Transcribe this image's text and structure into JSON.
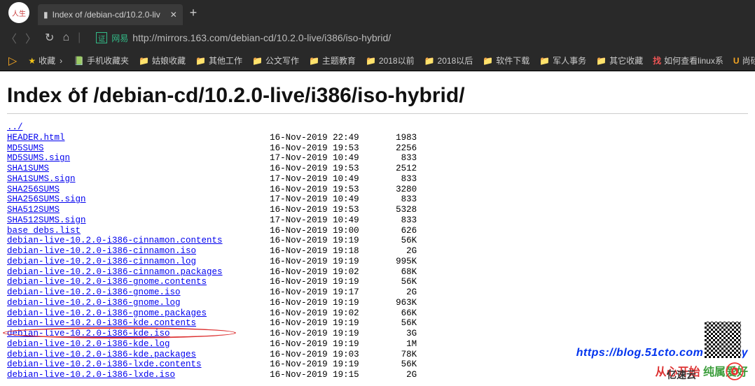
{
  "tab": {
    "title": "Index of /debian-cd/10.2.0-liv"
  },
  "url": "http://mirrors.163.com/debian-cd/10.2.0-live/i386/iso-hybrid/",
  "security_label": "网易",
  "bookmarks": {
    "fav": "收藏",
    "items": [
      "手机收藏夹",
      "姑娘收藏",
      "其他工作",
      "公文写作",
      "主题教育",
      "2018以前",
      "2018以后",
      "软件下载",
      "军人事务",
      "其它收藏",
      "如何查看linux系",
      "尚硅谷"
    ]
  },
  "page": {
    "heading": "Index of /debian-cd/10.2.0-live/i386/iso-hybrid/",
    "parent": "../",
    "rows": [
      {
        "name": "HEADER.html",
        "date": "16-Nov-2019 22:49",
        "size": "1983"
      },
      {
        "name": "MD5SUMS",
        "date": "16-Nov-2019 19:53",
        "size": "2256"
      },
      {
        "name": "MD5SUMS.sign",
        "date": "17-Nov-2019 10:49",
        "size": "833"
      },
      {
        "name": "SHA1SUMS",
        "date": "16-Nov-2019 19:53",
        "size": "2512"
      },
      {
        "name": "SHA1SUMS.sign",
        "date": "17-Nov-2019 10:49",
        "size": "833"
      },
      {
        "name": "SHA256SUMS",
        "date": "16-Nov-2019 19:53",
        "size": "3280"
      },
      {
        "name": "SHA256SUMS.sign",
        "date": "17-Nov-2019 10:49",
        "size": "833"
      },
      {
        "name": "SHA512SUMS",
        "date": "16-Nov-2019 19:53",
        "size": "5328"
      },
      {
        "name": "SHA512SUMS.sign",
        "date": "17-Nov-2019 10:49",
        "size": "833"
      },
      {
        "name": "base_debs.list",
        "date": "16-Nov-2019 19:00",
        "size": "626"
      },
      {
        "name": "debian-live-10.2.0-i386-cinnamon.contents",
        "date": "16-Nov-2019 19:19",
        "size": "56K"
      },
      {
        "name": "debian-live-10.2.0-i386-cinnamon.iso",
        "date": "16-Nov-2019 19:18",
        "size": "2G"
      },
      {
        "name": "debian-live-10.2.0-i386-cinnamon.log",
        "date": "16-Nov-2019 19:19",
        "size": "995K"
      },
      {
        "name": "debian-live-10.2.0-i386-cinnamon.packages",
        "date": "16-Nov-2019 19:02",
        "size": "68K"
      },
      {
        "name": "debian-live-10.2.0-i386-gnome.contents",
        "date": "16-Nov-2019 19:19",
        "size": "56K"
      },
      {
        "name": "debian-live-10.2.0-i386-gnome.iso",
        "date": "16-Nov-2019 19:17",
        "size": "2G"
      },
      {
        "name": "debian-live-10.2.0-i386-gnome.log",
        "date": "16-Nov-2019 19:19",
        "size": "963K"
      },
      {
        "name": "debian-live-10.2.0-i386-gnome.packages",
        "date": "16-Nov-2019 19:02",
        "size": "66K"
      },
      {
        "name": "debian-live-10.2.0-i386-kde.contents",
        "date": "16-Nov-2019 19:19",
        "size": "56K"
      },
      {
        "name": "debian-live-10.2.0-i386-kde.iso",
        "date": "16-Nov-2019 19:19",
        "size": "3G"
      },
      {
        "name": "debian-live-10.2.0-i386-kde.log",
        "date": "16-Nov-2019 19:19",
        "size": "1M"
      },
      {
        "name": "debian-live-10.2.0-i386-kde.packages",
        "date": "16-Nov-2019 19:03",
        "size": "78K"
      },
      {
        "name": "debian-live-10.2.0-i386-lxde.contents",
        "date": "16-Nov-2019 19:19",
        "size": "56K"
      },
      {
        "name": "debian-live-10.2.0-i386-lxde.iso",
        "date": "16-Nov-2019 19:15",
        "size": "2G"
      }
    ]
  },
  "watermark": {
    "url": "https://blog.51cto.com/ycrsjxy",
    "line_red": "从心开始",
    "line_green": "纯属爱好",
    "brand": "亿速云"
  },
  "highlight_index": 19
}
